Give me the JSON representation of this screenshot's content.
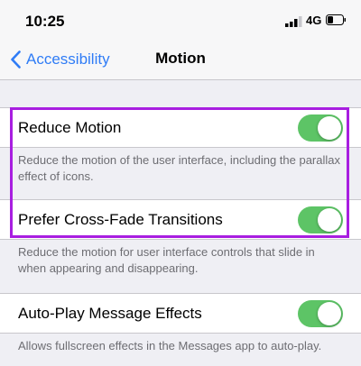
{
  "status_bar": {
    "time": "10:25",
    "network": "4G"
  },
  "nav": {
    "back_label": "Accessibility",
    "title": "Motion"
  },
  "settings": [
    {
      "label": "Reduce Motion",
      "on": true,
      "footer": "Reduce the motion of the user interface, including the parallax effect of icons."
    },
    {
      "label": "Prefer Cross-Fade Transitions",
      "on": true,
      "footer": "Reduce the motion for user interface controls that slide in when appearing and disappearing."
    },
    {
      "label": "Auto-Play Message Effects",
      "on": true,
      "footer": "Allows fullscreen effects in the Messages app to auto-play."
    }
  ],
  "colors": {
    "accent": "#2f7cf6",
    "toggle_on": "#5dc466",
    "highlight": "#a81ee0"
  },
  "icons": {
    "signal": "signal-icon",
    "battery": "battery-icon",
    "back": "chevron-left-icon"
  }
}
